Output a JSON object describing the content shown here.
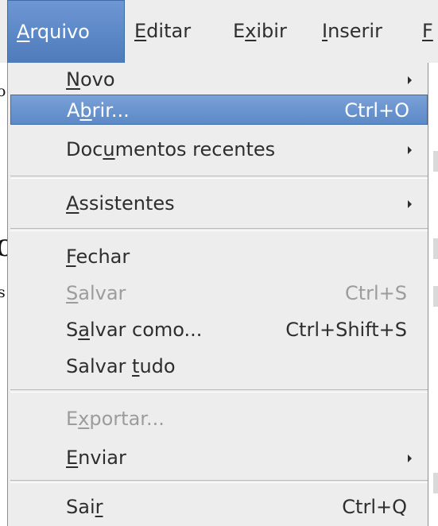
{
  "background": {
    "fragment_1": "o",
    "fragment_2": "O",
    "fragment_3": "s"
  },
  "menubar": {
    "items": [
      {
        "pre": "",
        "mnemonic": "A",
        "post": "rquivo",
        "active": true
      },
      {
        "pre": "",
        "mnemonic": "E",
        "post": "ditar",
        "active": false
      },
      {
        "pre": "E",
        "mnemonic": "x",
        "post": "ibir",
        "active": false
      },
      {
        "pre": "",
        "mnemonic": "I",
        "post": "nserir",
        "active": false
      },
      {
        "pre": "",
        "mnemonic": "F",
        "post": "",
        "active": false
      }
    ]
  },
  "menu": {
    "items": [
      {
        "pre": "",
        "mnemonic": "N",
        "post": "ovo",
        "shortcut": "",
        "submenu": true,
        "state": "normal"
      },
      {
        "pre": "A",
        "mnemonic": "b",
        "post": "rir...",
        "shortcut": "Ctrl+O",
        "submenu": false,
        "state": "highlighted"
      },
      {
        "pre": "Doc",
        "mnemonic": "u",
        "post": "mentos recentes",
        "shortcut": "",
        "submenu": true,
        "state": "normal"
      },
      {
        "pre": "",
        "mnemonic": "A",
        "post": "ssistentes",
        "shortcut": "",
        "submenu": true,
        "state": "normal"
      },
      {
        "pre": "",
        "mnemonic": "F",
        "post": "echar",
        "shortcut": "",
        "submenu": false,
        "state": "normal"
      },
      {
        "pre": "",
        "mnemonic": "S",
        "post": "alvar",
        "shortcut": "Ctrl+S",
        "submenu": false,
        "state": "disabled"
      },
      {
        "pre": "S",
        "mnemonic": "a",
        "post": "lvar como...",
        "shortcut": "Ctrl+Shift+S",
        "submenu": false,
        "state": "normal"
      },
      {
        "pre": "Salvar ",
        "mnemonic": "t",
        "post": "udo",
        "shortcut": "",
        "submenu": false,
        "state": "normal"
      },
      {
        "pre": "E",
        "mnemonic": "x",
        "post": "portar...",
        "shortcut": "",
        "submenu": false,
        "state": "disabled"
      },
      {
        "pre": "",
        "mnemonic": "E",
        "post": "nviar",
        "shortcut": "",
        "submenu": true,
        "state": "normal"
      },
      {
        "pre": "Sai",
        "mnemonic": "r",
        "post": "",
        "shortcut": "Ctrl+Q",
        "submenu": false,
        "state": "normal"
      }
    ]
  },
  "colors": {
    "highlight": "#5c89c7",
    "menu_background": "#ededed",
    "disabled_text": "#9c9c9c",
    "text": "#2e2e2e"
  }
}
